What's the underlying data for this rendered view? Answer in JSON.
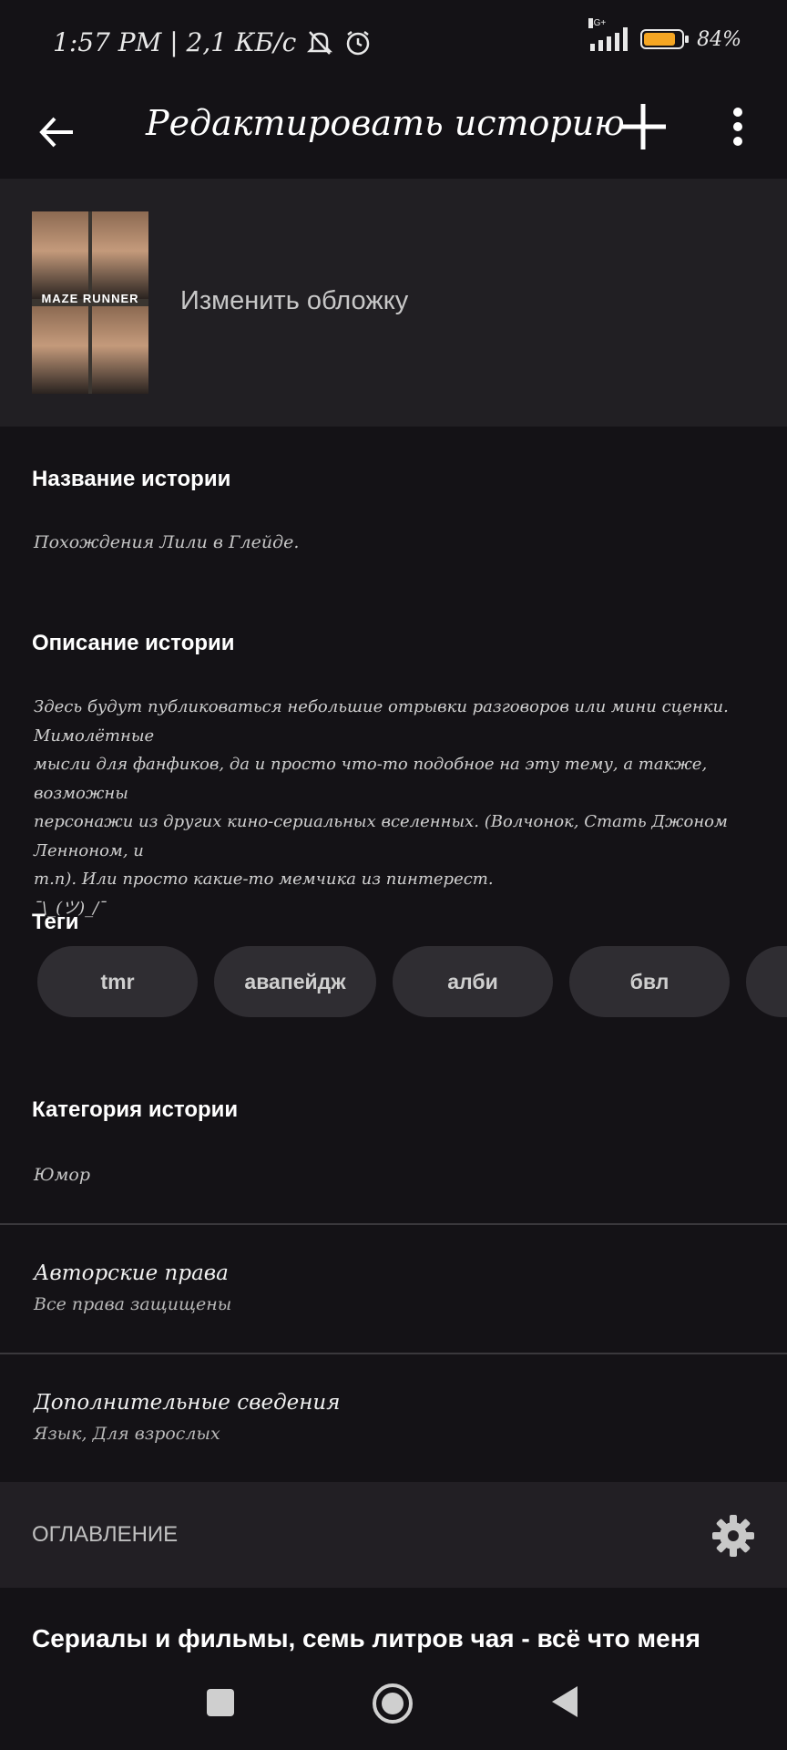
{
  "status_bar": {
    "time_speed": "1:57 PM | 2,1 КБ/с",
    "network": "4G+",
    "battery_level": 0.84,
    "battery_text": "84%",
    "colors": {
      "battery": "#f5a623"
    }
  },
  "app_bar": {
    "title": "Редактировать историю",
    "back_icon": "arrow-left-icon",
    "add_icon": "plus-icon",
    "more_icon": "more-vertical-icon"
  },
  "cover": {
    "change_label": "Изменить обложку",
    "logo_text": "MAZE RUNNER"
  },
  "story": {
    "title_label": "Название истории",
    "title_value": "Похождения Лили в Глейде.",
    "description_label": "Описание истории",
    "description_lines": [
      "Здесь будут публиковаться небольшие отрывки разговоров или мини сценки. Мимолётные",
      "мысли для фанфиков, да и просто что-то подобное на эту тему, а также, возможны",
      "персонажи из других кино-сериальных вселенных. (Волчонок, Стать Джоном Ленноном, и",
      "т.п). Или просто какие-то мемчика из пинтерест.",
      "¯\\_(ツ)_/¯"
    ],
    "tags_label": "Теги",
    "tags": [
      "tmr",
      "авапейдж",
      "алби",
      "бвл"
    ],
    "category_label": "Категория истории",
    "category_value": "Юмор"
  },
  "rows": {
    "copyright_title": "Авторские права",
    "copyright_value": "Все права защищены",
    "extra_title": "Дополнительные сведения",
    "extra_value": "Язык, Для взрослых"
  },
  "toc": {
    "label": "ОГЛАВЛЕНИЕ",
    "settings_icon": "gear-icon",
    "chapter_title": "Сериалы и фильмы, семь литров чая - всё что меня"
  },
  "nav": {
    "recent_icon": "square-icon",
    "home_icon": "circle-home-icon",
    "back_icon": "triangle-back-icon"
  }
}
